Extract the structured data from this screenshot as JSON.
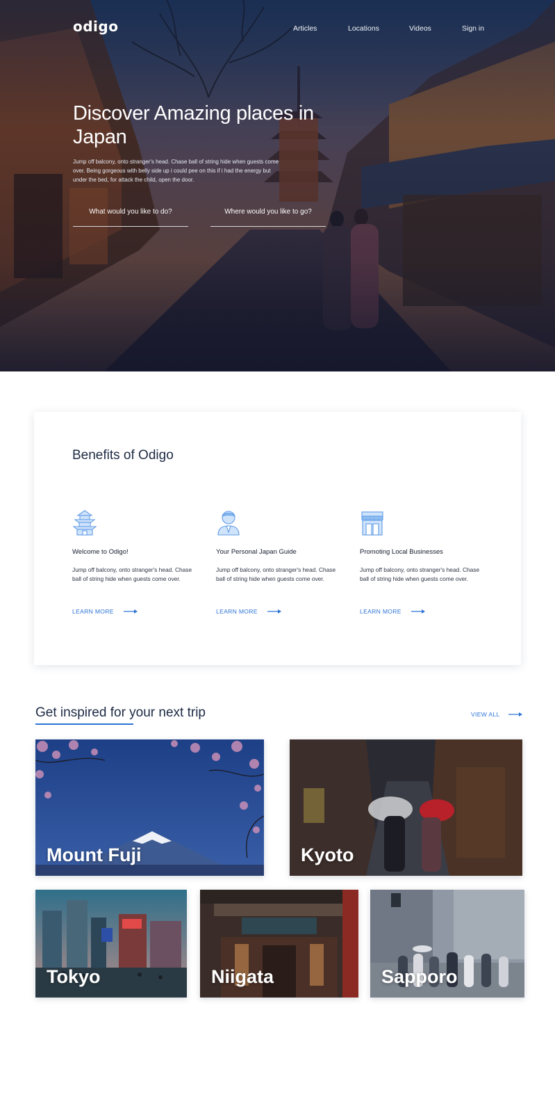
{
  "header": {
    "logo": "odigo",
    "nav": [
      "Articles",
      "Locations",
      "Videos",
      "Sign in"
    ]
  },
  "hero": {
    "title": "Discover Amazing places in Japan",
    "description": "Jump off balcony, onto stranger's head. Chase ball of string hide when guests come over. Being gorgeous with belly side up i could pee on this if i had the energy but under the bed, for attack the child, open the door.",
    "field_activity": "What would you like to do?",
    "field_location": "Where would you like to go?"
  },
  "benefits": {
    "title": "Benefits of Odigo",
    "items": [
      {
        "icon": "pagoda-icon",
        "heading": "Welcome to Odigo!",
        "text": "Jump off balcony, onto stranger's head. Chase ball of string hide when guests come over.",
        "link": "LEARN MORE"
      },
      {
        "icon": "guide-person-icon",
        "heading": "Your Personal Japan Guide",
        "text": "Jump off balcony, onto stranger's head. Chase ball of string hide when guests come over.",
        "link": "LEARN MORE"
      },
      {
        "icon": "storefront-icon",
        "heading": "Promoting Local Businesses",
        "text": "Jump off balcony, onto stranger's head. Chase ball of string hide when guests come over.",
        "link": "LEARN MORE"
      }
    ]
  },
  "inspired": {
    "title": "Get inspired for your next trip",
    "view_all": "VIEW ALL",
    "destinations": [
      "Mount Fuji",
      "Kyoto",
      "Tokyo",
      "Niigata",
      "Sapporo"
    ]
  },
  "colors": {
    "accent": "#2c74d6",
    "heading": "#1d2a44",
    "icon": "#8cbcf0"
  }
}
